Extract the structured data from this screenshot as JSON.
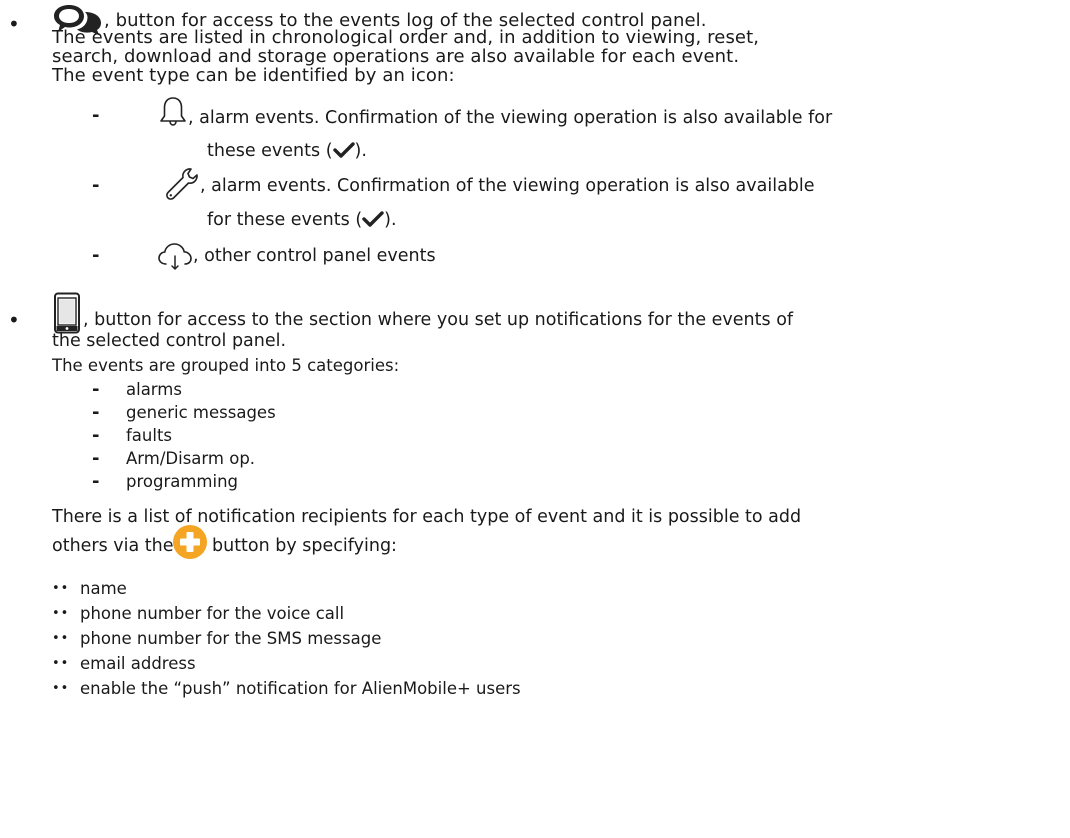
{
  "events_log": {
    "line1": ", button for access to the events log of the selected control panel.",
    "line2": "The events are listed in chronological order and, in addition to viewing, reset,",
    "line3": "search, download and storage operations are also available for each event.",
    "line4": "The event type can be identified by an icon:",
    "alarm": {
      "line1": ", alarm events. Confirmation of the viewing operation is also available for",
      "line2_pre": "these events (",
      "line2_post": ")."
    },
    "fault": {
      "line1": ", alarm events. Confirmation of the viewing operation is also available",
      "line2_pre": "for these events (",
      "line2_post": ")."
    },
    "other": {
      "line1": ", other control panel events"
    }
  },
  "notifications": {
    "line1": ", button for access to the section where you set up notifications for the events of",
    "line2": "the selected control panel.",
    "line3": "The events are grouped into 5 categories:",
    "categories": [
      "alarms",
      "generic messages",
      "faults",
      "Arm/Disarm op.",
      "programming"
    ],
    "recipients_line1": "There is a list of notification recipients for each type of event and it is possible to add",
    "recipients_line2_pre": "others via the",
    "recipients_line2_post": "button by specifying:",
    "fields": [
      "name",
      "phone number for the voice call",
      "phone number for the SMS message",
      "email address",
      "enable the “push” notification for AlienMobile+ users"
    ]
  },
  "symbols": {
    "bullet": "•",
    "dash": "-",
    "double_bullet": "••"
  },
  "icons": {
    "events_log": "chat-bubbles-icon",
    "alarm": "bell-icon",
    "fault": "wrench-icon",
    "other": "cloud-download-icon",
    "confirm": "checkmark-icon",
    "notifications": "smartphone-icon",
    "add": "add-plus-icon"
  },
  "colors": {
    "text": "#1a1a1a",
    "icon": "#222222",
    "add_button": "#f5a524",
    "add_plus": "#ffffff"
  }
}
